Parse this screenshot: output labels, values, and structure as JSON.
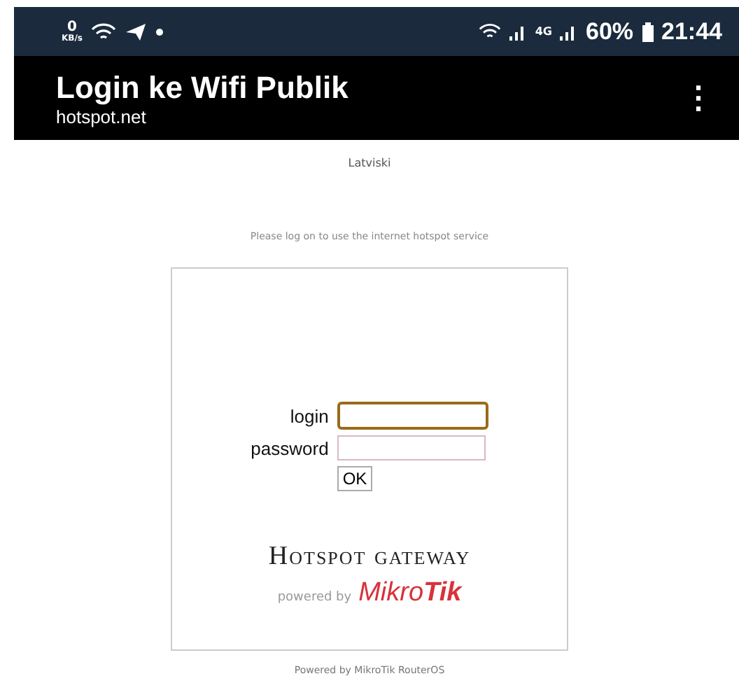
{
  "status_bar": {
    "net_speed_value": "0",
    "net_speed_unit": "KB/s",
    "network_type": "4G",
    "battery": "60%",
    "time": "21:44"
  },
  "app_bar": {
    "title": "Login ke Wifi Publik",
    "subtitle": "hotspot.net",
    "menu": "⋮"
  },
  "language_link": "Latviski",
  "message": "Please log on to use the internet hotspot service",
  "form": {
    "fields": [
      {
        "label": "login",
        "focused": true
      },
      {
        "label": "password",
        "focused": false
      }
    ],
    "submit": "OK"
  },
  "branding": {
    "title": "Hotspot gateway",
    "powered_by": "powered by",
    "brand_a": "Mikro",
    "brand_b": "Tik"
  },
  "footer": "Powered by MikroTik RouterOS"
}
